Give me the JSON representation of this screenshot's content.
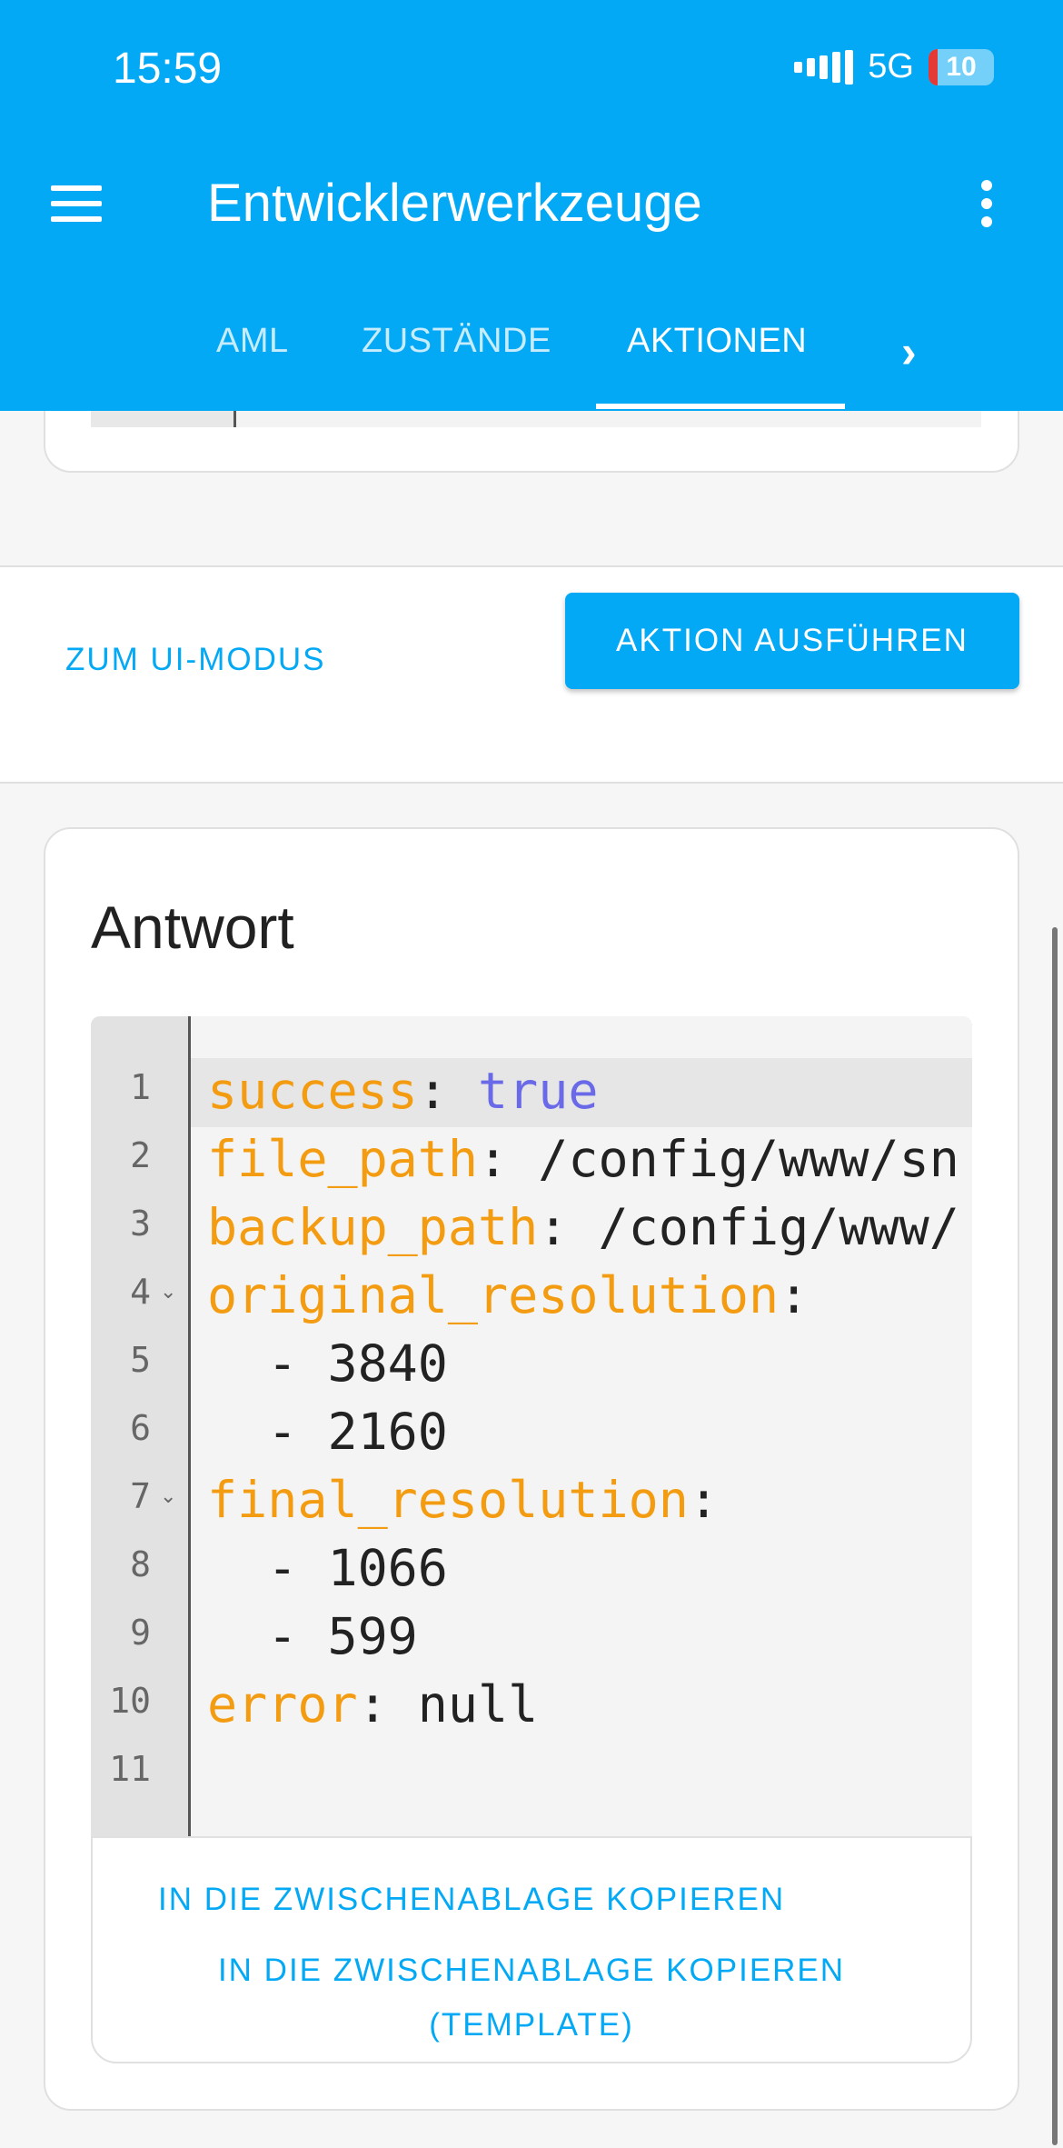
{
  "status_bar": {
    "time": "15:59",
    "network": "5G",
    "battery": "10"
  },
  "appbar": {
    "title": "Entwicklerwerkzeuge"
  },
  "tabs": [
    {
      "label": "AML"
    },
    {
      "label": "ZUSTÄNDE"
    },
    {
      "label": "AKTIONEN",
      "active": true
    }
  ],
  "actions": {
    "ui_mode_label": "ZUM UI-MODUS",
    "run_label": "AKTION AUSFÜHREN"
  },
  "response": {
    "title": "Antwort",
    "line_numbers": [
      "1",
      "2",
      "3",
      "4",
      "5",
      "6",
      "7",
      "8",
      "9",
      "10",
      "11"
    ],
    "code": {
      "l1_key": "success",
      "l1_sep": ": ",
      "l1_val": "true",
      "l2_key": "file_path",
      "l2_rest": ": /config/www/sn",
      "l3_key": "backup_path",
      "l3_rest": ": /config/www/",
      "l4_key": "original_resolution",
      "l4_rest": ":",
      "l5": "  - 3840",
      "l6": "  - 2160",
      "l7_key": "final_resolution",
      "l7_rest": ":",
      "l8": "  - 1066",
      "l9": "  - 599",
      "l10_key": "error",
      "l10_rest": ": null"
    },
    "copy_label": "IN DIE ZWISCHENABLAGE KOPIEREN",
    "copy_template_label_1": "IN DIE ZWISCHENABLAGE KOPIEREN",
    "copy_template_label_2": "(TEMPLATE)"
  }
}
